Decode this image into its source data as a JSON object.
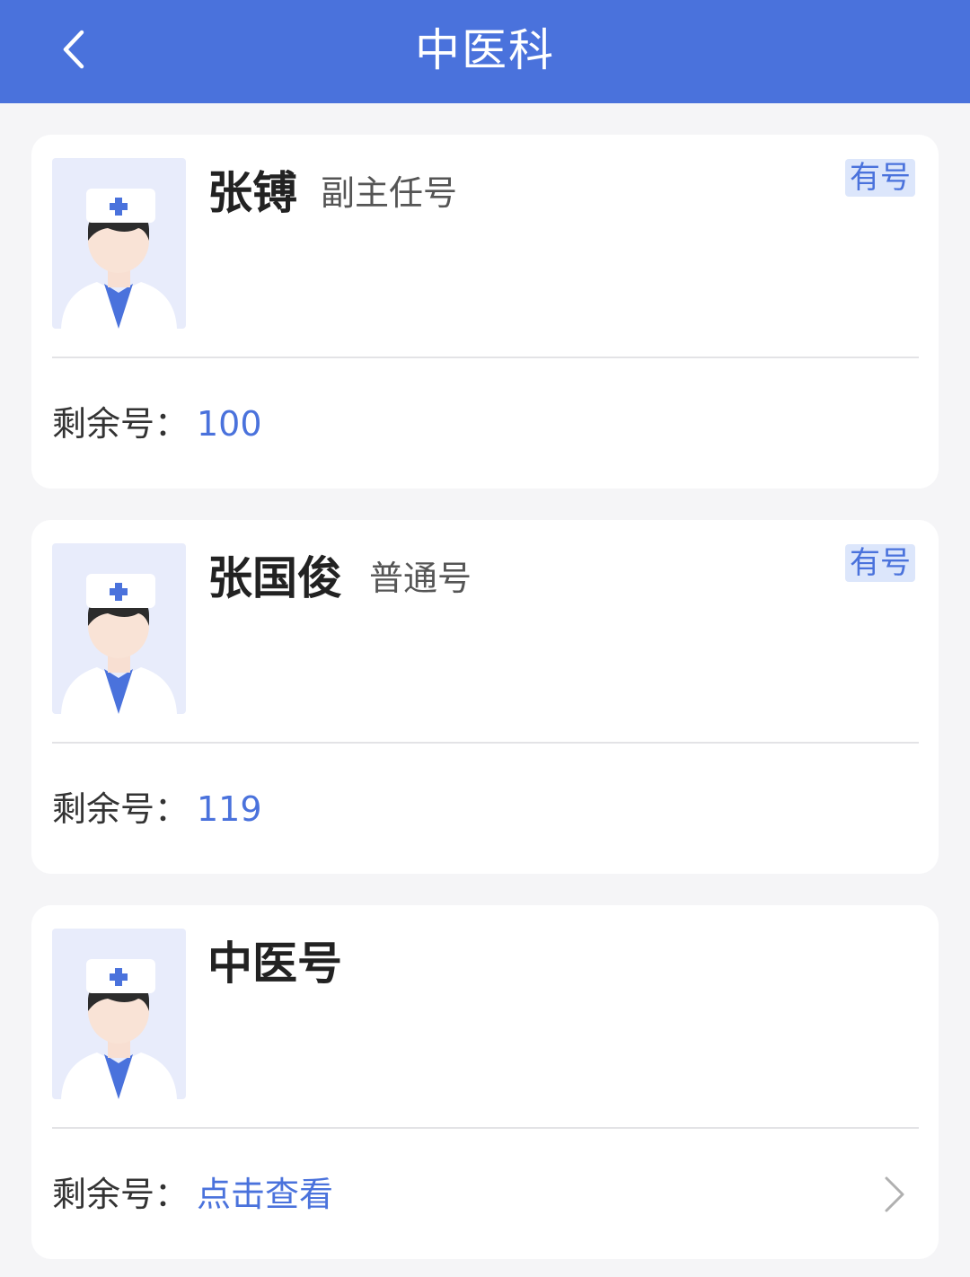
{
  "header": {
    "title": "中医科",
    "back_icon": "chevron-left-icon"
  },
  "colors": {
    "nav_background": "#4a72dc",
    "accent": "#4a72dc",
    "badge_background": "#dce6fb",
    "page_background": "#f5f5f7"
  },
  "doctors": [
    {
      "name": "张镈",
      "level": "副主任号",
      "badge": "有号",
      "remaining_label": "剩余号：",
      "remaining_value": "100"
    },
    {
      "name": "张国俊",
      "level": "普通号",
      "badge": "有号",
      "remaining_label": "剩余号：",
      "remaining_value": "119"
    },
    {
      "name": "中医号",
      "remaining_label": "剩余号：",
      "remaining_value": "点击查看",
      "action_icon": "chevron-right-icon"
    }
  ]
}
